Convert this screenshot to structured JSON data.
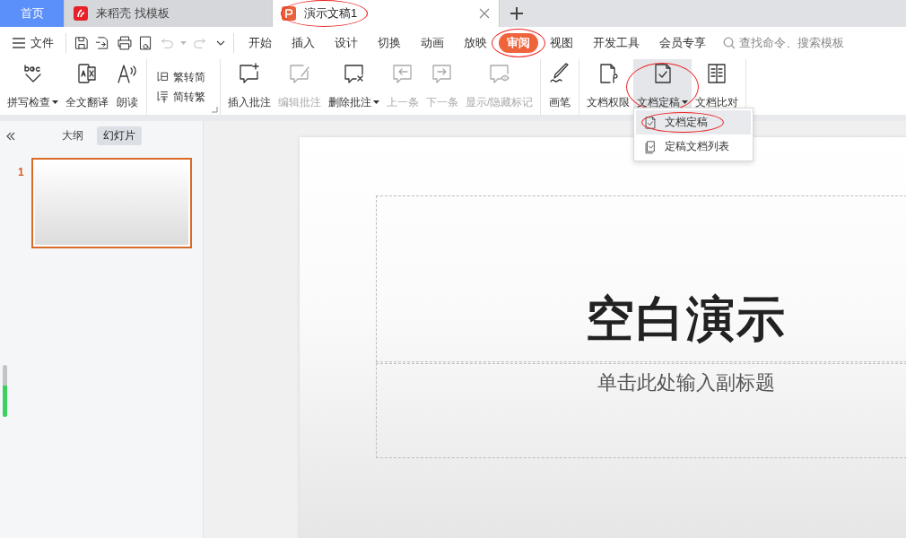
{
  "tabs": [
    {
      "label": "首页",
      "kind": "home",
      "selected": false
    },
    {
      "label": "来稻壳 找模板",
      "kind": "docer",
      "selected": false
    },
    {
      "label": "演示文稿1",
      "kind": "presentation",
      "selected": true,
      "circled": true
    }
  ],
  "menu_bar": {
    "file_label": "文件",
    "quick_access": [
      {
        "disabled": false
      },
      {
        "disabled": false
      },
      {
        "disabled": false
      },
      {
        "disabled": false
      },
      {
        "disabled": true,
        "dropdown": true
      },
      {
        "disabled": true,
        "dropdown": false
      }
    ],
    "tabs": [
      {
        "label": "开始",
        "selected": false
      },
      {
        "label": "插入",
        "selected": false
      },
      {
        "label": "设计",
        "selected": false
      },
      {
        "label": "切换",
        "selected": false
      },
      {
        "label": "动画",
        "selected": false
      },
      {
        "label": "放映",
        "selected": false
      },
      {
        "label": "审阅",
        "selected": true,
        "circled": true
      },
      {
        "label": "视图",
        "selected": false
      },
      {
        "label": "开发工具",
        "selected": false
      },
      {
        "label": "会员专享",
        "selected": false
      }
    ],
    "search": {
      "placeholder": "查找命令、搜索模板"
    }
  },
  "ribbon": {
    "groups": [
      {
        "kind": "large",
        "items": [
          {
            "label": "拼写检查",
            "disabled": false,
            "dropdown": true
          },
          {
            "label": "全文翻译",
            "disabled": false,
            "dropdown": false
          },
          {
            "label": "朗读",
            "disabled": false,
            "dropdown": false
          }
        ]
      },
      {
        "kind": "stack",
        "items": [
          {
            "label": "繁转简",
            "disabled": false
          },
          {
            "label": "简转繁",
            "disabled": false
          }
        ]
      },
      {
        "kind": "large",
        "items": [
          {
            "label": "插入批注",
            "disabled": false,
            "dropdown": false
          },
          {
            "label": "编辑批注",
            "disabled": true,
            "dropdown": false
          },
          {
            "label": "删除批注",
            "disabled": false,
            "dropdown": true
          },
          {
            "label": "上一条",
            "disabled": true,
            "dropdown": false
          },
          {
            "label": "下一条",
            "disabled": true,
            "dropdown": false
          },
          {
            "label": "显示/隐藏标记",
            "disabled": true,
            "dropdown": false
          }
        ]
      },
      {
        "kind": "large",
        "items": [
          {
            "label": "画笔",
            "disabled": false,
            "dropdown": false
          }
        ]
      },
      {
        "kind": "large",
        "items": [
          {
            "label": "文档权限",
            "disabled": false,
            "dropdown": false
          },
          {
            "label": "文档定稿",
            "disabled": false,
            "dropdown": true,
            "expanded": true,
            "circled": true,
            "menu": [
              {
                "label": "文档定稿",
                "highlighted": true,
                "circled": true
              },
              {
                "label": "定稿文档列表",
                "highlighted": false
              }
            ]
          },
          {
            "label": "文档比对",
            "disabled": false,
            "dropdown": false
          }
        ]
      }
    ]
  },
  "side_panel": {
    "tabs": [
      {
        "label": "大纲",
        "selected": false
      },
      {
        "label": "幻灯片",
        "selected": true
      }
    ],
    "slides": [
      {
        "number": "1",
        "selected": true
      }
    ]
  },
  "slide": {
    "title": "空白演示",
    "subtitle": "单击此处输入副标题"
  }
}
